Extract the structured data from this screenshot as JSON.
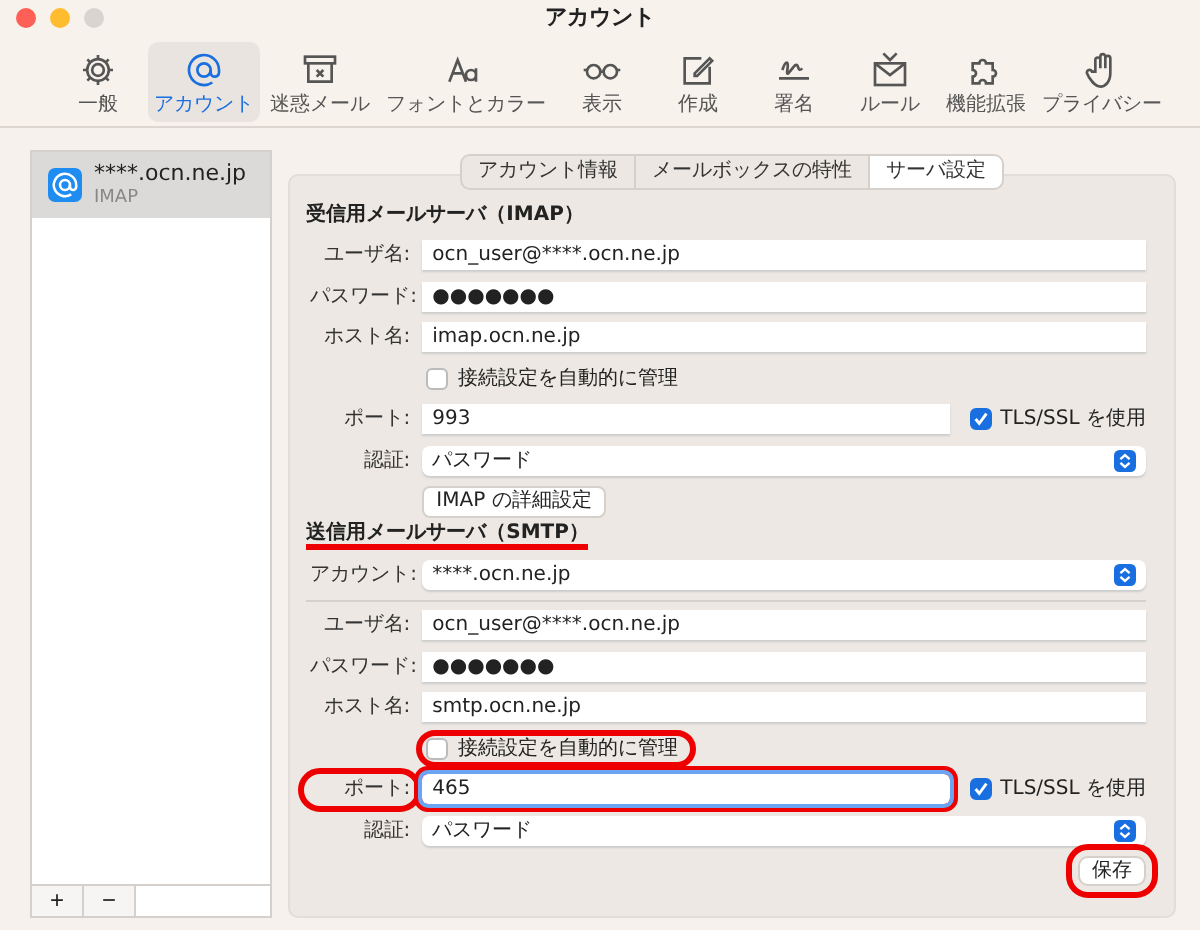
{
  "window": {
    "title": "アカウント"
  },
  "toolbar": [
    {
      "label": "一般",
      "selected": false
    },
    {
      "label": "アカウント",
      "selected": true
    },
    {
      "label": "迷惑メール",
      "selected": false
    },
    {
      "label": "フォントとカラー",
      "selected": false
    },
    {
      "label": "表示",
      "selected": false
    },
    {
      "label": "作成",
      "selected": false
    },
    {
      "label": "署名",
      "selected": false
    },
    {
      "label": "ルール",
      "selected": false
    },
    {
      "label": "機能拡張",
      "selected": false
    },
    {
      "label": "プライバシー",
      "selected": false
    }
  ],
  "accounts": [
    {
      "name": "****.ocn.ne.jp",
      "type": "IMAP",
      "selected": true
    }
  ],
  "sidebar_buttons": [
    "+",
    "−"
  ],
  "tabs": [
    {
      "label": "アカウント情報",
      "selected": false
    },
    {
      "label": "メールボックスの特性",
      "selected": false
    },
    {
      "label": "サーバ設定",
      "selected": true
    }
  ],
  "sections": [
    {
      "heading": "受信用メールサーバ（IMAP）",
      "underlined": false,
      "rows": [
        {
          "kind": "text",
          "label": "ユーザ名:",
          "value": "ocn_user@****.ocn.ne.jp"
        },
        {
          "kind": "text",
          "label": "パスワード:",
          "value": "●●●●●●●"
        },
        {
          "kind": "text",
          "label": "ホスト名:",
          "value": "imap.ocn.ne.jp"
        },
        {
          "kind": "checkbox",
          "label": "接続設定を自動的に管理",
          "checked": false,
          "highlighted": false
        },
        {
          "kind": "port",
          "label": "ポート:",
          "value": "993",
          "focused": false,
          "highlighted": false,
          "tls": {
            "label": "TLS/SSL を使用",
            "checked": true
          }
        },
        {
          "kind": "select",
          "label": "認証:",
          "value": "パスワード"
        },
        {
          "kind": "button",
          "label": "IMAP の詳細設定"
        }
      ]
    },
    {
      "heading": "送信用メールサーバ（SMTP）",
      "underlined": true,
      "rows": [
        {
          "kind": "select",
          "label": "アカウント:",
          "value": "****.ocn.ne.jp"
        },
        {
          "kind": "divider"
        },
        {
          "kind": "text",
          "label": "ユーザ名:",
          "value": "ocn_user@****.ocn.ne.jp"
        },
        {
          "kind": "text",
          "label": "パスワード:",
          "value": "●●●●●●●"
        },
        {
          "kind": "text",
          "label": "ホスト名:",
          "value": "smtp.ocn.ne.jp"
        },
        {
          "kind": "checkbox",
          "label": "接続設定を自動的に管理",
          "checked": false,
          "highlighted": true
        },
        {
          "kind": "port",
          "label": "ポート:",
          "value": "465",
          "focused": true,
          "highlighted": true,
          "tls": {
            "label": "TLS/SSL を使用",
            "checked": true
          }
        },
        {
          "kind": "select",
          "label": "認証:",
          "value": "パスワード"
        }
      ]
    }
  ],
  "save_button": {
    "label": "保存",
    "highlighted": true
  }
}
